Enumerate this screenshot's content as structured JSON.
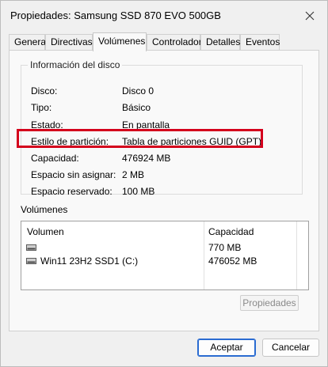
{
  "window": {
    "title": "Propiedades: Samsung SSD 870 EVO 500GB"
  },
  "tabs": [
    {
      "label": "General"
    },
    {
      "label": "Directivas"
    },
    {
      "label": "Volúmenes"
    },
    {
      "label": "Controlador"
    },
    {
      "label": "Detalles"
    },
    {
      "label": "Eventos"
    }
  ],
  "active_tab": "Volúmenes",
  "disk_info": {
    "group_title": "Información del disco",
    "rows": [
      {
        "label": "Disco:",
        "value": "Disco 0"
      },
      {
        "label": "Tipo:",
        "value": "Básico"
      },
      {
        "label": "Estado:",
        "value": "En pantalla"
      },
      {
        "label": "Estilo de partición:",
        "value": "Tabla de particiones GUID (GPT)"
      },
      {
        "label": "Capacidad:",
        "value": "476924 MB"
      },
      {
        "label": "Espacio sin asignar:",
        "value": "2 MB"
      },
      {
        "label": "Espacio reservado:",
        "value": "100 MB"
      }
    ],
    "highlight_color": "#d4001c"
  },
  "volumes": {
    "section_label": "Volúmenes",
    "columns": {
      "volume": "Volumen",
      "capacity": "Capacidad"
    },
    "rows": [
      {
        "name": "",
        "capacity": "770 MB",
        "icon": "drive-icon"
      },
      {
        "name": "Win11 23H2 SSD1 (C:)",
        "capacity": "476052 MB",
        "icon": "drive-icon"
      }
    ],
    "properties_button": "Propiedades"
  },
  "footer": {
    "ok_label": "Aceptar",
    "cancel_label": "Cancelar",
    "accent_color": "#2a6bd1"
  }
}
